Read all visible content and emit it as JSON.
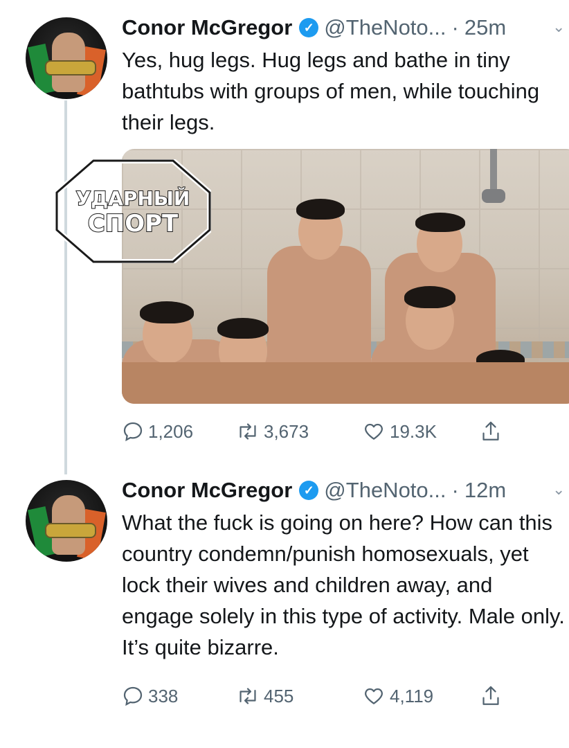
{
  "tweets": [
    {
      "name": "Conor McGregor",
      "handle": "@TheNoto...",
      "separator": "·",
      "time": "25m",
      "text": "Yes, hug legs. Hug legs and bathe in tiny bathtubs with groups of men, while touching their legs.",
      "watermark": [
        "УДАРНЫЙ",
        "СПОРТ"
      ],
      "stats": {
        "replies": "1,206",
        "retweets": "3,673",
        "likes": "19.3K"
      }
    },
    {
      "name": "Conor McGregor",
      "handle": "@TheNoto...",
      "separator": "·",
      "time": "12m",
      "text": "What the fuck is going on here? How can this country condemn/punish homosexuals, yet lock their wives and children away, and engage solely in this type of activity. Male only.\nIt’s quite bizarre.",
      "stats": {
        "replies": "338",
        "retweets": "455",
        "likes": "4,119"
      }
    }
  ],
  "colors": {
    "verified": "#1d9bf0",
    "muted": "#536471",
    "thread_line": "#cfd9de"
  },
  "icons": [
    "verified-badge-icon",
    "chevron-down-icon",
    "reply-icon",
    "retweet-icon",
    "like-icon",
    "share-icon"
  ]
}
